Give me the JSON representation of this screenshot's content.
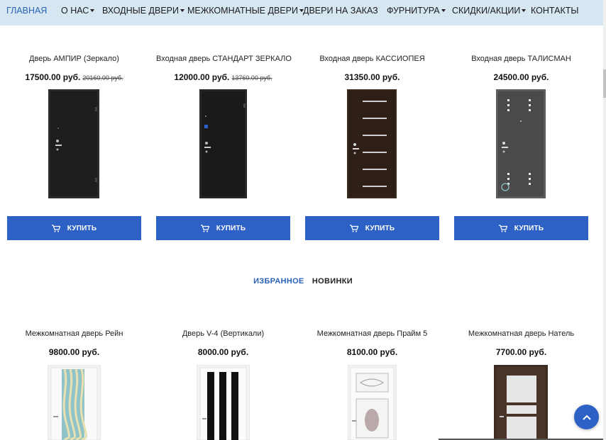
{
  "nav": {
    "items": [
      {
        "label": "ГЛАВНАЯ",
        "active": true,
        "dropdown": false
      },
      {
        "label": "О НАС",
        "active": false,
        "dropdown": true
      },
      {
        "label": "ВХОДНЫЕ ДВЕРИ",
        "active": false,
        "dropdown": true
      },
      {
        "label": "МЕЖКОМНАТНЫЕ ДВЕРИ",
        "active": false,
        "dropdown": true
      },
      {
        "label": "ДВЕРИ НА ЗАКАЗ",
        "active": false,
        "dropdown": false
      },
      {
        "label": "ФУРНИТУРА",
        "active": false,
        "dropdown": true
      },
      {
        "label": "СКИДКИ/АКЦИИ",
        "active": false,
        "dropdown": true
      },
      {
        "label": "КОНТАКТЫ",
        "active": false,
        "dropdown": false
      }
    ]
  },
  "products_top": [
    {
      "title": "Дверь АМПИР (Зеркало)",
      "price": "17500.00 руб.",
      "old_price": "20160.00 руб.",
      "buy_label": "КУПИТЬ"
    },
    {
      "title": "Входная дверь СТАНДАРТ ЗЕРКАЛО",
      "price": "12000.00 руб.",
      "old_price": "13760.00 руб.",
      "buy_label": "КУПИТЬ"
    },
    {
      "title": "Входная дверь КАССИОПЕЯ",
      "price": "31350.00 руб.",
      "old_price": "",
      "buy_label": "КУПИТЬ"
    },
    {
      "title": "Входная дверь ТАЛИСМАН",
      "price": "24500.00 руб.",
      "old_price": "",
      "buy_label": "КУПИТЬ"
    }
  ],
  "tabs": {
    "favorites": "ИЗБРАННОЕ",
    "new": "НОВИНКИ"
  },
  "products_bottom": [
    {
      "title": "Межкомнатная дверь Рейн",
      "price": "9800.00 руб."
    },
    {
      "title": "Дверь V-4 (Вертикали)",
      "price": "8000.00 руб."
    },
    {
      "title": "Межкомнатная дверь Прайм 5",
      "price": "8100.00 руб."
    },
    {
      "title": "Межкомнатная дверь Натель",
      "price": "7700.00 руб."
    }
  ],
  "colors": {
    "nav_bg": "#d6e7f2",
    "accent": "#2d61c6",
    "active_link": "#2a62b7"
  },
  "icons": {
    "cart": "cart-icon",
    "scroll_top": "arrow-up-icon"
  }
}
